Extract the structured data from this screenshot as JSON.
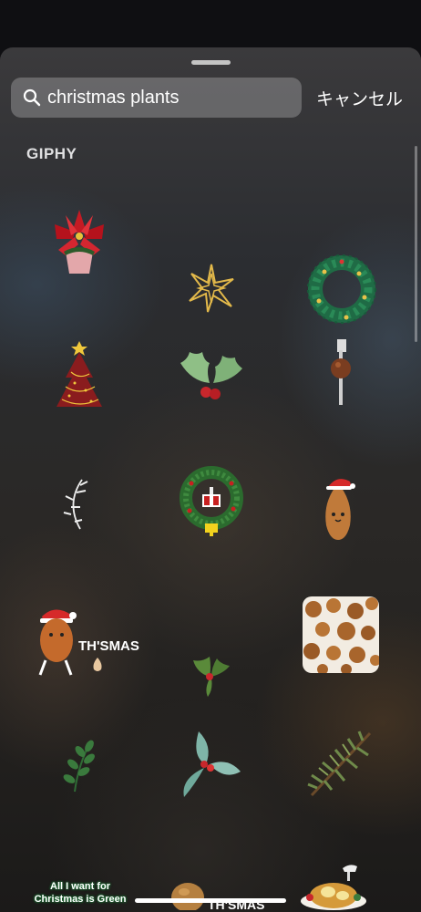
{
  "search": {
    "query": "christmas plants",
    "cancel_label": "キャンセル"
  },
  "section": {
    "label": "GIPHY"
  },
  "stickers": [
    {
      "name": "poinsettia-sticker"
    },
    {
      "name": "gold-star-sticker"
    },
    {
      "name": "wreath-sticker"
    },
    {
      "name": "christmas-tree-sticker"
    },
    {
      "name": "holly-sticker"
    },
    {
      "name": "meatball-fork-sticker"
    },
    {
      "name": "laurel-branch-sticker"
    },
    {
      "name": "pixel-wreath-sticker"
    },
    {
      "name": "almond-santa-sticker"
    },
    {
      "name": "thismas-sausage-sticker",
      "text": "TH'SMAS"
    },
    {
      "name": "small-holly-sticker"
    },
    {
      "name": "nuts-square-sticker"
    },
    {
      "name": "green-sprig-sticker"
    },
    {
      "name": "blue-holly-sticker"
    },
    {
      "name": "pine-branch-sticker"
    },
    {
      "name": "all-i-want-sticker",
      "line1": "All I want for",
      "line2": "Christmas is Green"
    },
    {
      "name": "bread-thismas-sticker",
      "text": "TH'SMAS"
    },
    {
      "name": "roast-dinner-sticker"
    }
  ]
}
